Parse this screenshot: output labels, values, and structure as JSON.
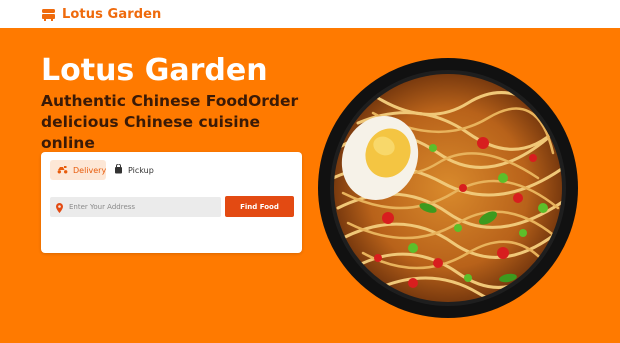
{
  "header": {
    "brand_name": "Lotus Garden",
    "brand_icon": "food-truck-icon"
  },
  "hero": {
    "title": "Lotus Garden",
    "tagline": "Authentic Chinese FoodOrder delicious Chinese cuisine online"
  },
  "order_form": {
    "tabs": [
      {
        "label": "Delivery",
        "icon": "scooter-icon",
        "active": true
      },
      {
        "label": "Pickup",
        "icon": "shopping-bag-icon",
        "active": false
      }
    ],
    "address_placeholder": "Enter Your Address",
    "address_value": "",
    "location_icon": "map-pin-icon",
    "submit_label": "Find Food"
  },
  "colors": {
    "accent": "#ff7a00",
    "brand": "#ef6a0c",
    "button": "#e34a12",
    "tagline": "#3a1a07"
  }
}
